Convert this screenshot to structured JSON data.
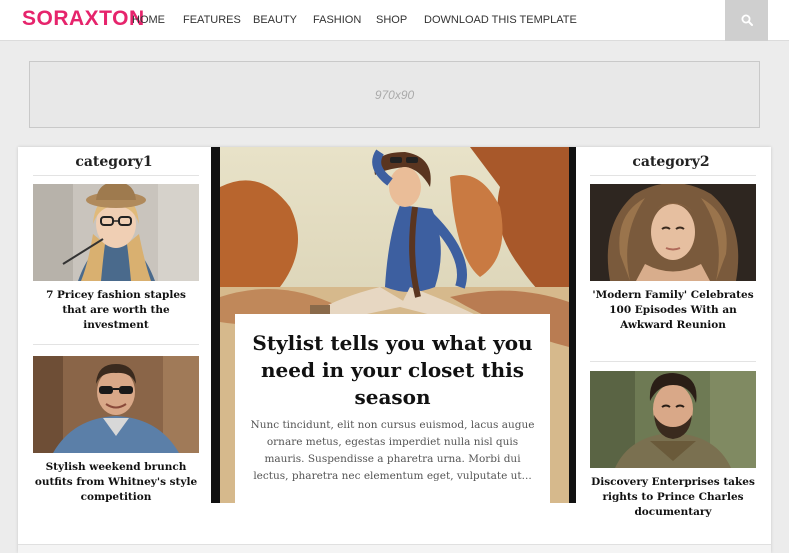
{
  "header": {
    "logo": "SORAXTON",
    "nav": [
      "HOME",
      "FEATURES",
      "BEAUTY",
      "FASHION",
      "SHOP",
      "DOWNLOAD THIS TEMPLATE"
    ],
    "search_icon": "search-icon"
  },
  "ad": {
    "label": "970x90"
  },
  "left_column": {
    "title": "category1",
    "posts": [
      {
        "title": "7 Pricey fashion staples that are worth the investment"
      },
      {
        "title": "Stylish weekend brunch outfits from Whitney's style competition"
      }
    ]
  },
  "featured": {
    "title": "Stylist tells you what you need in your closet this season",
    "excerpt": "Nunc tincidunt, elit non cursus euismod, lacus augue ornare metus, egestas imperdiet nulla nisl quis mauris. Suspendisse a pharetra urna. Morbi dui lectus, pharetra nec elementum eget, vulputate ut..."
  },
  "right_column": {
    "title": "category2",
    "posts": [
      {
        "title": "'Modern Family' Celebrates 100 Episodes With an Awkward Reunion"
      },
      {
        "title": "Discovery Enterprises takes rights to Prince Charles documentary"
      }
    ]
  },
  "colors": {
    "brand": "#e6246c",
    "background": "#ececec",
    "search_button": "#cfcfcf"
  }
}
